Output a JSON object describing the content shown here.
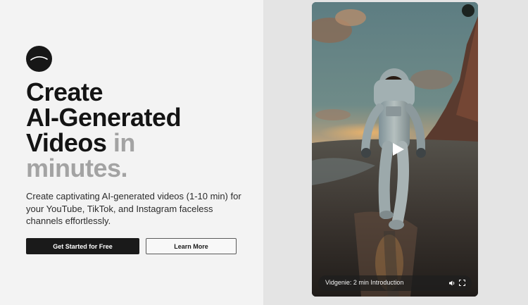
{
  "hero": {
    "headline_lines": [
      "Create",
      "AI-Generated",
      "Videos"
    ],
    "headline_muted_inline": " in",
    "headline_muted_line": "minutes.",
    "description": "Create captivating AI-generated videos (1-10 min) for your YouTube, TikTok, and Instagram faceless channels effortlessly.",
    "primary_cta": "Get Started for Free",
    "secondary_cta": "Learn More"
  },
  "video": {
    "title": "Vidgenie: 2 min Introduction",
    "icons": {
      "play": "play-icon",
      "volume": "volume-icon",
      "fullscreen": "fullscreen-icon"
    }
  },
  "colors": {
    "left_bg": "#f3f3f3",
    "right_bg": "#e4e4e4",
    "primary": "#1a1a1a",
    "muted_text": "#a3a3a3"
  }
}
